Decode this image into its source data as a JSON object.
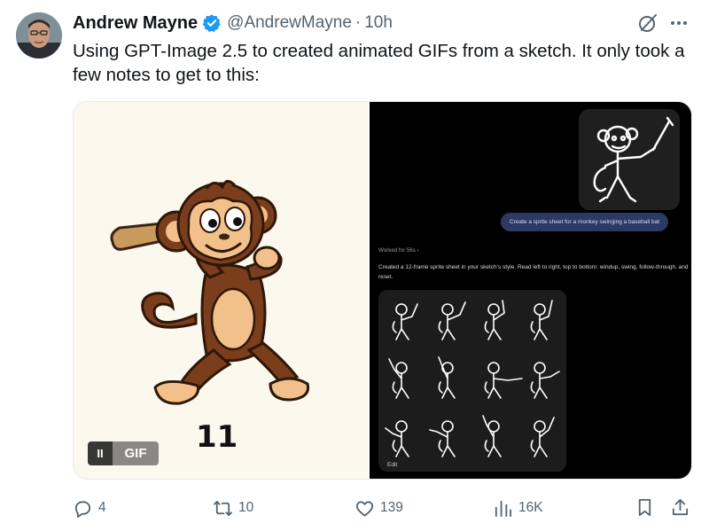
{
  "author": {
    "name": "Andrew Mayne",
    "handle": "@AndrewMayne",
    "separator": "·",
    "time": "10h"
  },
  "post": {
    "text": "Using GPT-Image 2.5 to created animated GIFs from a sketch. It only took a few notes to get to this:"
  },
  "media": {
    "left": {
      "frame_number": "11",
      "pause_label": "II",
      "gif_badge": "GIF"
    },
    "right": {
      "prompt": "Create a sprite sheet for a monkey swinging a baseball bat",
      "worked_for": "Worked for 56s  ›",
      "reply": "Created a 12-frame sprite sheet in your sketch's style. Read left to right, top to bottom: windup, swing, follow-through, and reset.",
      "edit_label": "Edit"
    }
  },
  "actions": {
    "replies": "4",
    "reposts": "10",
    "likes": "139",
    "views": "16K"
  },
  "icons": [
    "verified-badge-icon",
    "grok-icon",
    "more-icon",
    "reply-icon",
    "repost-icon",
    "like-icon",
    "views-icon",
    "bookmark-icon",
    "share-icon"
  ],
  "colors": {
    "verified": "#1d9bf0",
    "secondary_text": "#536471",
    "monkey_brown": "#7a3e1d",
    "monkey_tan": "#f2c08a",
    "bat": "#c99a5b",
    "prompt_bubble": "#2a3a64"
  }
}
